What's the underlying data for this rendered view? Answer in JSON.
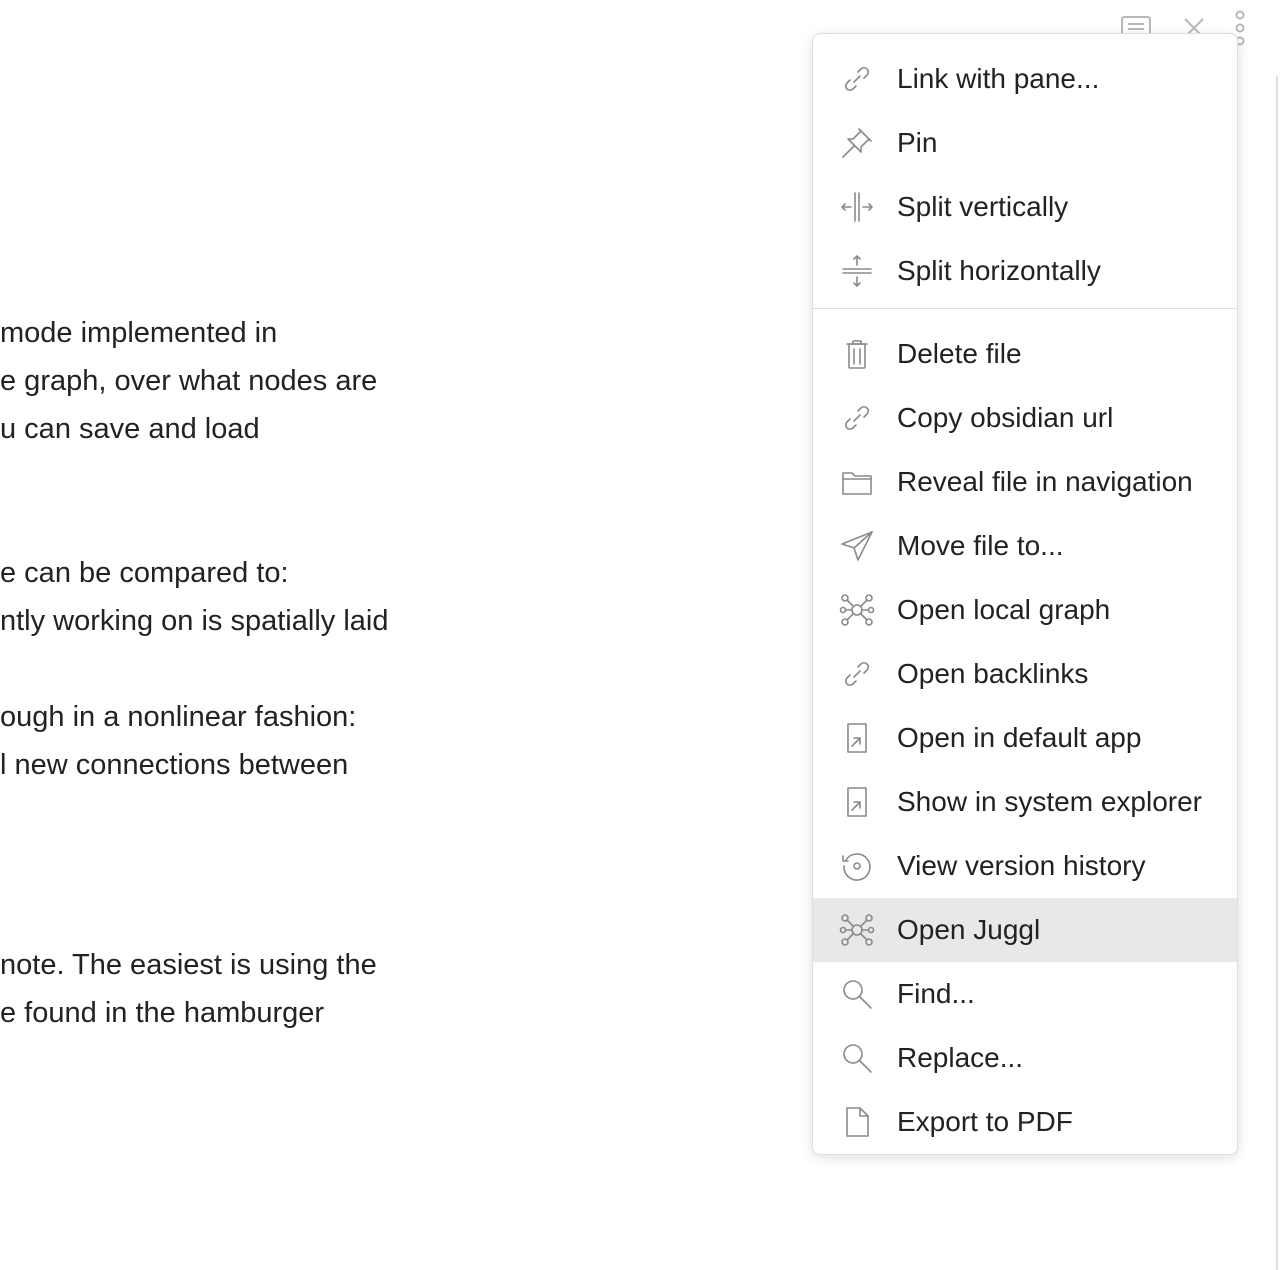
{
  "editor": {
    "paragraphs": [
      [
        "mode implemented in",
        "e graph, over what nodes are",
        "u can save and load"
      ],
      [
        "e can be compared to:",
        "ntly working on is spatially laid"
      ],
      [
        "ough in a nonlinear fashion:",
        "l new connections between"
      ],
      [
        "note. The easiest is using the",
        "e found in the hamburger"
      ]
    ]
  },
  "header": {
    "icons": [
      "reading-mode-icon",
      "close-icon",
      "more-options-icon"
    ]
  },
  "menu": {
    "groups": [
      [
        {
          "label": "Link with pane...",
          "icon": "link-icon"
        },
        {
          "label": "Pin",
          "icon": "pin-icon"
        },
        {
          "label": "Split vertically",
          "icon": "split-vertical-icon"
        },
        {
          "label": "Split horizontally",
          "icon": "split-horizontal-icon"
        }
      ],
      [
        {
          "label": "Delete file",
          "icon": "trash-icon"
        },
        {
          "label": "Copy obsidian url",
          "icon": "link-icon"
        },
        {
          "label": "Reveal file in navigation",
          "icon": "folder-icon"
        },
        {
          "label": "Move file to...",
          "icon": "paper-plane-icon"
        },
        {
          "label": "Open local graph",
          "icon": "graph-icon"
        },
        {
          "label": "Open backlinks",
          "icon": "link-icon"
        },
        {
          "label": "Open in default app",
          "icon": "open-external-icon"
        },
        {
          "label": "Show in system explorer",
          "icon": "open-external-icon"
        },
        {
          "label": "View version history",
          "icon": "history-icon"
        },
        {
          "label": "Open Juggl",
          "icon": "graph-icon",
          "active": true
        },
        {
          "label": "Find...",
          "icon": "search-icon"
        },
        {
          "label": "Replace...",
          "icon": "search-icon"
        },
        {
          "label": "Export to PDF",
          "icon": "file-icon"
        }
      ]
    ]
  },
  "colors": {
    "text": "#222222",
    "icon": "#8a8a8a",
    "highlight": "#e8e8e8",
    "border": "#dedede"
  }
}
